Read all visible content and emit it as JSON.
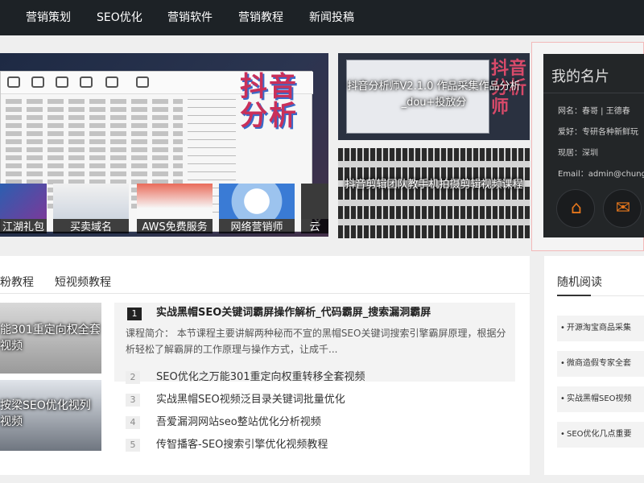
{
  "nav": {
    "items": [
      "营销策划",
      "SEO优化",
      "营销软件",
      "营销教程",
      "新闻投稿"
    ]
  },
  "hero": {
    "art_text": "抖音分析",
    "close": "x",
    "thumbs": [
      "江湖礼包",
      "买卖域名",
      "AWS免费服务",
      "网络营销师",
      "云"
    ]
  },
  "cards": [
    {
      "caption": "抖音分析师V2.1.0 作品采集作品分析_dou+投放分",
      "art_text": "抖音分析师"
    },
    {
      "caption": "抖音剪辑团队教手机拍摄剪辑视频课程"
    }
  ],
  "profile": {
    "title": "我的名片",
    "rows": [
      "网名：春哥 | 王德春",
      "爱好：专研各种新鲜玩",
      "现居：深圳",
      "Email：admin@chung"
    ],
    "buttons": [
      "home-icon",
      "mail-icon"
    ],
    "accent": "#e6771c"
  },
  "main": {
    "tabs": [
      "粉教程",
      "短视频教程"
    ],
    "videos": [
      {
        "caption": "能301重定向权全套视频"
      },
      {
        "caption": "按梁SEO优化视列视频"
      }
    ],
    "featured": {
      "num": "1",
      "title": "实战黑帽SEO关键词霸屏操作解析_代码霸屏_搜索漏洞霸屏",
      "summary": "课程简介：  本节课程主要讲解两种秘而不宣的黑帽SEO关键词搜索引擎霸屏原理，根据分析轻松了解霸屏的工作原理与操作方式，让成千..."
    },
    "articles": [
      {
        "num": "2",
        "title": "SEO优化之万能301重定向权重转移全套视频"
      },
      {
        "num": "3",
        "title": "实战黑帽SEO视频泛目录关键词批量优化"
      },
      {
        "num": "4",
        "title": "吾爱漏洞网站seo整站优化分析视频"
      },
      {
        "num": "5",
        "title": "传智播客-SEO搜索引擎优化视频教程"
      }
    ]
  },
  "random": {
    "title": "随机阅读",
    "items": [
      "开源淘宝商品采集",
      "微商造假专家全套",
      "实战黑帽SEO视频",
      "SEO优化几点重要"
    ]
  }
}
